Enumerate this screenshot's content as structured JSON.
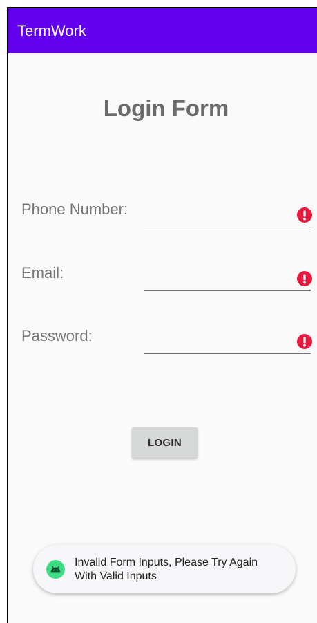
{
  "app": {
    "title": "TermWork",
    "accent_color": "#6200ee"
  },
  "form": {
    "title": "Login Form",
    "fields": [
      {
        "label": "Phone Number:",
        "value": "",
        "error_icon": "error-icon"
      },
      {
        "label": "Email:",
        "value": "",
        "error_icon": "error-icon"
      },
      {
        "label": "Password:",
        "value": "",
        "error_icon": "error-icon"
      }
    ],
    "error_color": "#e8193c",
    "login_label": "LOGIN"
  },
  "toast": {
    "icon": "android-icon",
    "message": "Invalid Form Inputs, Please Try Again With Valid Inputs"
  }
}
